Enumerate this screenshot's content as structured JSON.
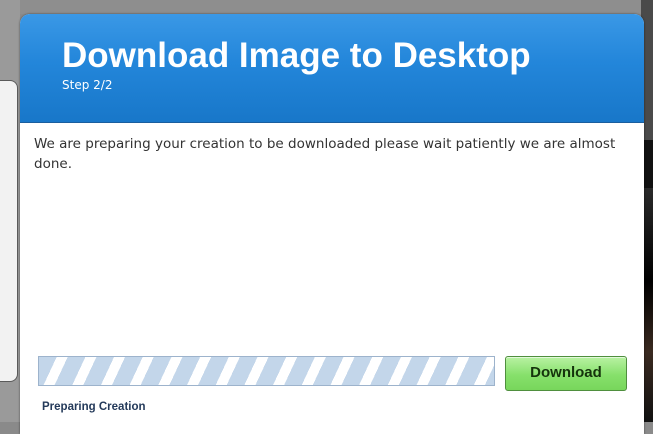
{
  "dialog": {
    "title": "Download Image to Desktop",
    "step": "Step 2/2",
    "message": "We are preparing your creation to be downloaded please wait patiently we are almost done.",
    "progress_fraction": 1.0,
    "status": "Preparing Creation",
    "download_label": "Download"
  },
  "colors": {
    "header": "#2386da",
    "progress_stripe": "#c3d6ea",
    "download_button": "#86e06b"
  }
}
